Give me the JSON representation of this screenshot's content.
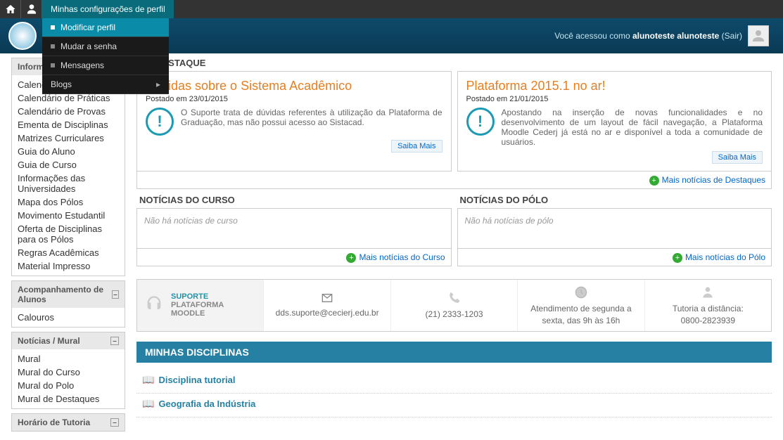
{
  "topbar": {
    "menu_label": "Minhas configurações de perfil",
    "dropdown": [
      {
        "label": "Modificar perfil",
        "active": true
      },
      {
        "label": "Mudar a senha"
      },
      {
        "label": "Mensagens"
      },
      {
        "label": "Blogs",
        "has_sub": true
      }
    ]
  },
  "header": {
    "prefix": "Você acessou como ",
    "username": "alunoteste alunoteste",
    "logout": "Sair"
  },
  "sidebar": {
    "blocks": [
      {
        "title": "Informaç",
        "truncated": true,
        "items": [
          "Calendário Acadêmico",
          "Calendário de Práticas",
          "Calendário de Provas",
          "Ementa de Disciplinas",
          "Matrizes Curriculares",
          "Guia do Aluno",
          "Guia de Curso",
          "Informações das Universidades",
          "Mapa dos Pólos",
          "Movimento Estudantil",
          "Oferta de Disciplinas para os Pólos",
          "Regras Acadêmicas",
          "Material Impresso"
        ]
      },
      {
        "title": "Acompanhamento de Alunos",
        "items": [
          "Calouros"
        ]
      },
      {
        "title": "Notícias / Mural",
        "items": [
          "Mural",
          "Mural do Curso",
          "Mural do Polo",
          "Mural de Destaques"
        ]
      },
      {
        "title": "Horário de Tutoria",
        "items": []
      }
    ]
  },
  "featured": {
    "heading": "EM DESTAQUE",
    "cards": [
      {
        "title": "Dúvidas sobre o Sistema Acadêmico",
        "date": "Postado em 23/01/2015",
        "text": "O Suporte trata de dúvidas referentes à utilização da Plataforma de Graduação, mas não possui acesso ao Sistacad.",
        "more": "Saiba Mais"
      },
      {
        "title": "Plataforma 2015.1 no ar!",
        "date": "Postado em 21/01/2015",
        "text": "Apostando na inserção de novas funcionalidades e no desenvolvimento de um layout de fácil navegação, a Plataforma Moodle Cederj já está no ar e disponível a toda a comunidade de usuários.",
        "more": "Saiba Mais"
      }
    ],
    "more_all": "Mais notícias de Destaques"
  },
  "news": {
    "curso": {
      "heading": "NOTÍCIAS DO CURSO",
      "empty": "Não há notícias de curso",
      "more": "Mais notícias do Curso"
    },
    "polo": {
      "heading": "NOTÍCIAS DO PÓLO",
      "empty": "Não há notícias de pólo",
      "more": "Mais notícias do Pólo"
    }
  },
  "support": {
    "title": "SUPORTE",
    "sub": "PLATAFORMA MOODLE",
    "email": "dds.suporte@cecierj.edu.br",
    "phone": "(21) 2333-1203",
    "hours1": "Atendimento de segunda a",
    "hours2": "sexta, das 9h às 16h",
    "tut1": "Tutoria a distância:",
    "tut2": "0800-2823939"
  },
  "disciplines": {
    "heading": "MINHAS DISCIPLINAS",
    "items": [
      "Disciplina tutorial",
      "Geografia da Indústria"
    ]
  }
}
